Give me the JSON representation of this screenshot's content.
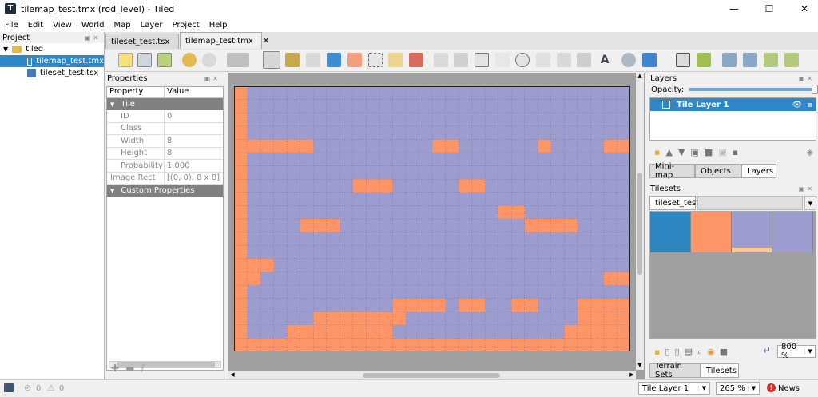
{
  "window": {
    "title": "tilemap_test.tmx (rod_level) - Tiled",
    "min": "—",
    "max": "☐",
    "close": "✕"
  },
  "menu": [
    "File",
    "Edit",
    "View",
    "World",
    "Map",
    "Layer",
    "Project",
    "Help"
  ],
  "project": {
    "header": "Project",
    "folder": "tiled",
    "files": [
      "tilemap_test.tmx",
      "tileset_test.tsx"
    ]
  },
  "tabs": [
    {
      "label": "tileset_test.tsx",
      "close": "✕"
    },
    {
      "label": "tilemap_test.tmx",
      "close": "✕"
    }
  ],
  "properties": {
    "header": "Properties",
    "col_property": "Property",
    "col_value": "Value",
    "group_tile": "Tile",
    "rows": [
      {
        "k": "ID",
        "v": "0"
      },
      {
        "k": "Class",
        "v": ""
      },
      {
        "k": "Width",
        "v": "8"
      },
      {
        "k": "Height",
        "v": "8"
      },
      {
        "k": "Probability",
        "v": "1.000"
      },
      {
        "k": "Image Rect",
        "v": "[(0, 0), 8 x 8]"
      }
    ],
    "group_custom": "Custom Properties"
  },
  "layers": {
    "header": "Layers",
    "opacity_label": "Opacity:",
    "opacity": 1.0,
    "items": [
      {
        "name": "Tile Layer 1"
      }
    ],
    "tabs": [
      "Mini-map",
      "Objects",
      "Layers"
    ]
  },
  "tilesets": {
    "header": "Tilesets",
    "tab": "tileset_test",
    "tiles": [
      "#2e86c1",
      "#fe9567",
      "#9c9cce",
      "#9c9cce"
    ],
    "zoom": "800 %",
    "bottom_tabs": [
      "Terrain Sets",
      "Tilesets"
    ]
  },
  "map": {
    "cols": 30,
    "rows": 20,
    "colors": {
      "bg": "#9c9cce",
      "fill": "#fe9567",
      "grid": "#6a6a9a",
      "border": "#222222"
    },
    "solid": [
      [
        0,
        0,
        30
      ],
      [
        0,
        1,
        20
      ],
      [
        1,
        4,
        5
      ],
      [
        15,
        4,
        2
      ],
      [
        23,
        4,
        1
      ],
      [
        28,
        4,
        2
      ],
      [
        9,
        7,
        3
      ],
      [
        17,
        7,
        2
      ],
      [
        20,
        9,
        2
      ],
      [
        5,
        10,
        3
      ],
      [
        22,
        10,
        4
      ],
      [
        1,
        13,
        2
      ],
      [
        28,
        14,
        2
      ],
      [
        1,
        14,
        1
      ],
      [
        12,
        16,
        4
      ],
      [
        17,
        16,
        2
      ],
      [
        21,
        16,
        2
      ],
      [
        26,
        16,
        4
      ],
      [
        6,
        17,
        7
      ],
      [
        26,
        17,
        4
      ],
      [
        4,
        18,
        8
      ],
      [
        25,
        18,
        5
      ],
      [
        1,
        19,
        29
      ]
    ]
  },
  "status": {
    "errors": "0",
    "warnings": "0",
    "layer": "Tile Layer 1",
    "zoom": "265 %",
    "news": "News"
  }
}
